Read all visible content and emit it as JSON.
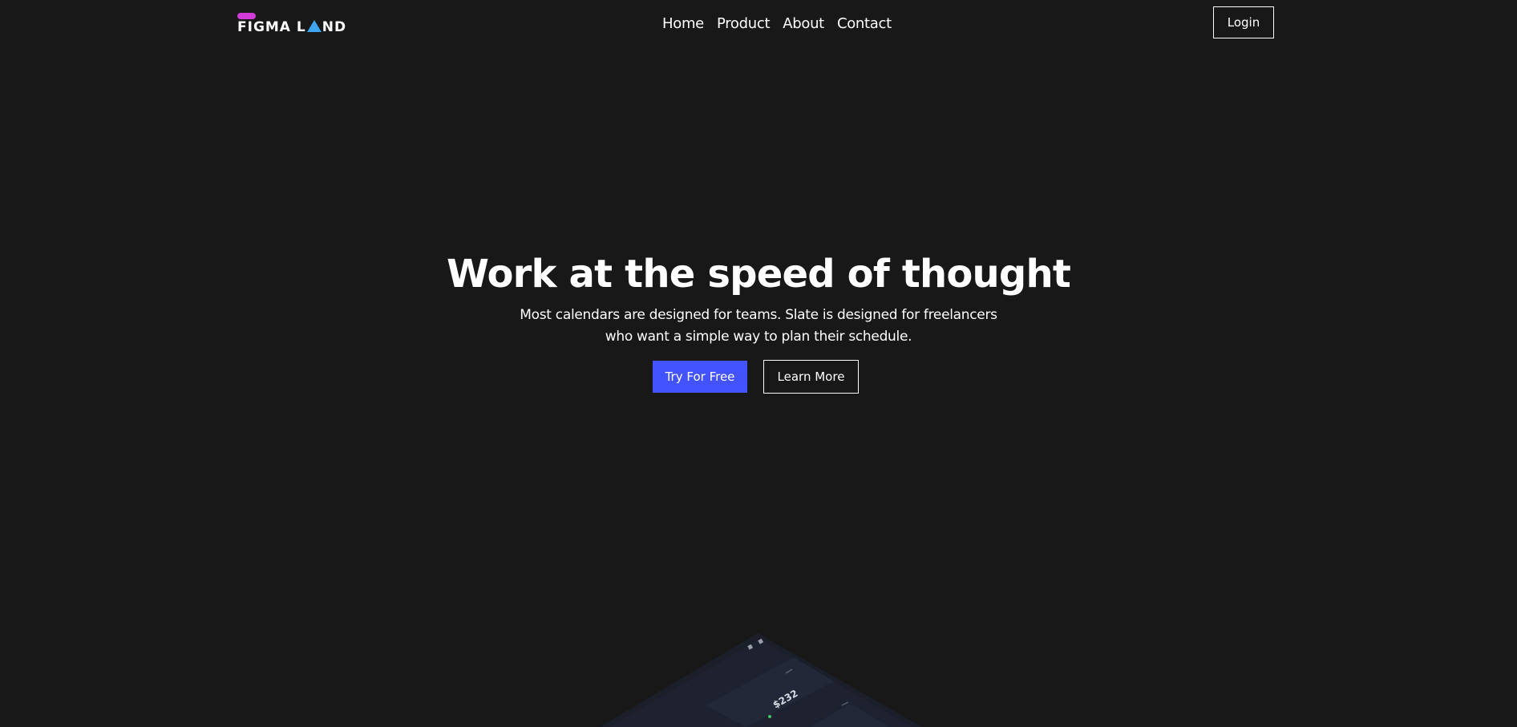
{
  "header": {
    "logo": {
      "pill_color": "#d13cd9",
      "text_before": "FIGMA L",
      "text_after": "ND",
      "triangle_color": "#3fa4f2"
    },
    "nav": [
      {
        "label": "Home"
      },
      {
        "label": "Product"
      },
      {
        "label": "About"
      },
      {
        "label": "Contact"
      }
    ],
    "login_label": "Login"
  },
  "hero": {
    "title": "Work at the speed of thought",
    "subtitle_line1": "Most calendars are designed for teams. Slate is designed for freelancers",
    "subtitle_line2": "who want a simple way to plan their schedule.",
    "primary_cta": "Try For Free",
    "secondary_cta": "Learn More"
  },
  "mockup": {
    "amount": "$232"
  },
  "colors": {
    "background": "#181818",
    "accent": "#4353ff",
    "text": "#ffffff"
  }
}
